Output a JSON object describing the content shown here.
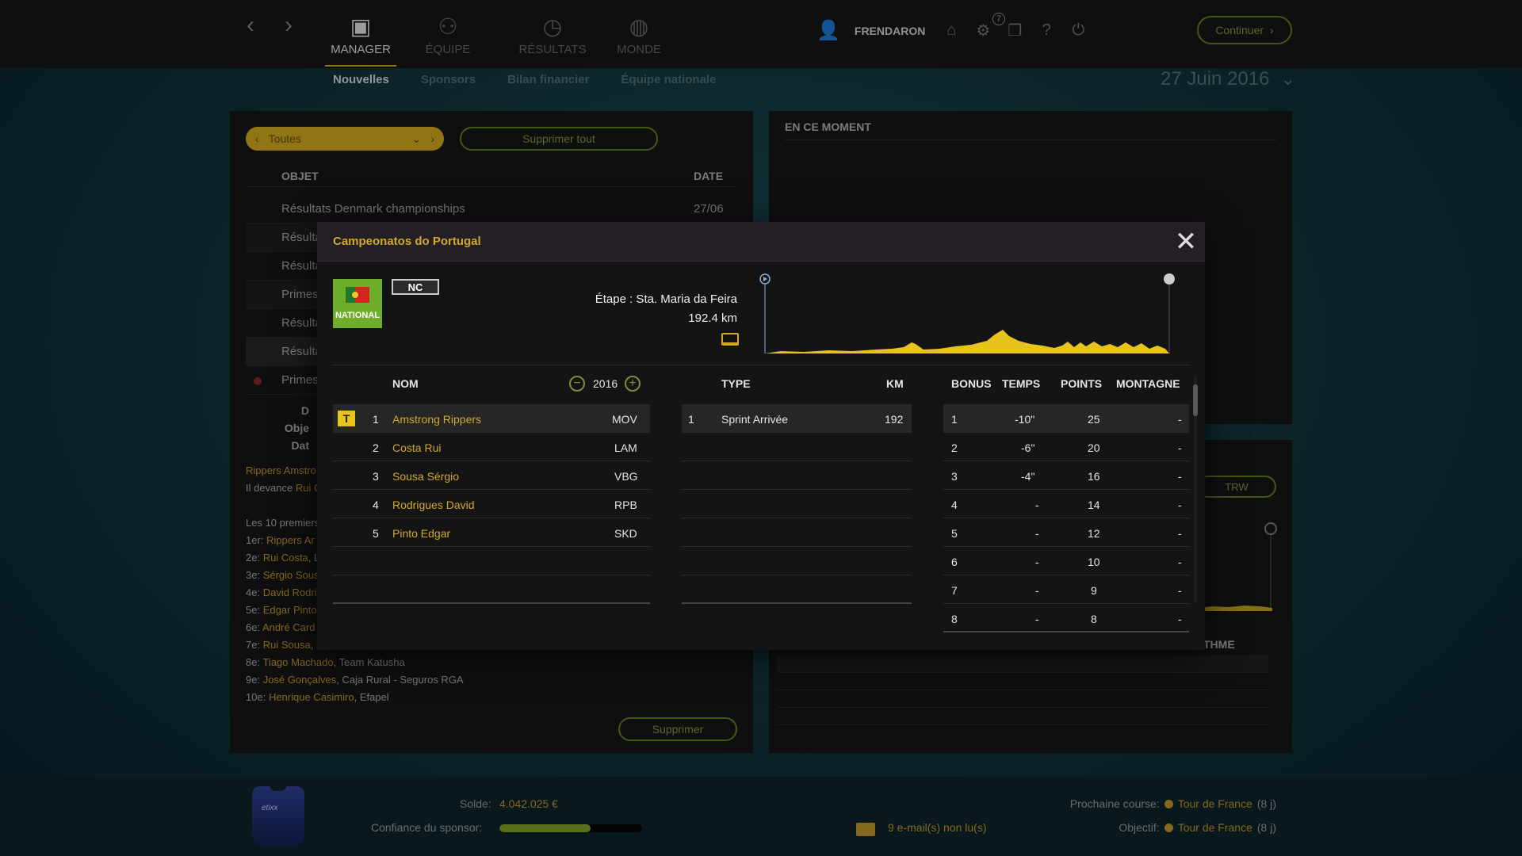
{
  "nav": {
    "main_tabs": [
      {
        "label": "MANAGER",
        "icon": "briefcase-icon"
      },
      {
        "label": "ÉQUIPE",
        "icon": "team-icon"
      },
      {
        "label": "RÉSULTATS",
        "icon": "stopwatch-icon"
      },
      {
        "label": "MONDE",
        "icon": "globe-icon"
      }
    ],
    "sub_tabs": [
      "Nouvelles",
      "Sponsors",
      "Bilan financier",
      "Équipe nationale"
    ],
    "username": "FRENDARON",
    "notif_count": "7",
    "continue_label": "Continuer",
    "date": "27 Juin 2016"
  },
  "news": {
    "filter": "Toutes",
    "delete_all": "Supprimer tout",
    "col_object": "OBJET",
    "col_date": "DATE",
    "rows": [
      {
        "title": "Résultats Denmark championships",
        "date": "27/06"
      },
      {
        "title": "Résulta"
      },
      {
        "title": "Résulta"
      },
      {
        "title": "Primes"
      },
      {
        "title": "Résulta"
      },
      {
        "title": "Résulta"
      },
      {
        "title": "Primes"
      }
    ],
    "detail_labels": [
      "D",
      "Obje",
      "Dat"
    ],
    "body": {
      "line1_name": "Rippers Amstro",
      "line2_prefix": "Il devance ",
      "line2_name": "Rui C",
      "top10_title": "Les 10 premiers",
      "top10": [
        {
          "rank": "1er:",
          "name": "Rippers Ar",
          "team": ""
        },
        {
          "rank": "2e:",
          "name": "Rui Costa",
          "team": ", L"
        },
        {
          "rank": "3e:",
          "name": "Sérgio Sous",
          "team": ""
        },
        {
          "rank": "4e:",
          "name": "David Rodri",
          "team": ""
        },
        {
          "rank": "5e:",
          "name": "Edgar Pinto",
          "team": ""
        },
        {
          "rank": "6e:",
          "name": "André Card",
          "team": ""
        },
        {
          "rank": "7e:",
          "name": "Rui Sousa",
          "team": ", R"
        },
        {
          "rank": "8e:",
          "name": "Tiago Machado",
          "team": ", Team Katusha"
        },
        {
          "rank": "9e:",
          "name": "José Gonçalves",
          "team": ", Caja Rural - Seguros RGA"
        },
        {
          "rank": "10e:",
          "name": "Henrique Casimiro",
          "team": ", Efapel"
        }
      ]
    },
    "delete_label": "Supprimer"
  },
  "right": {
    "moment_title": "EN CE MOMENT",
    "trw_label": "TRW",
    "rythme_label": "THME"
  },
  "modal": {
    "title": "Campeonatos do Portugal",
    "flag_label": "NATIONAL",
    "badge": "NC",
    "stage": "Étape : Sta. Maria da Feira",
    "distance": "192.4 km",
    "year": "2016",
    "riders_header": "NOM",
    "riders": [
      {
        "rank": "1",
        "name": "Amstrong Rippers",
        "team": "MOV",
        "badge": "T"
      },
      {
        "rank": "2",
        "name": "Costa Rui",
        "team": "LAM"
      },
      {
        "rank": "3",
        "name": "Sousa Sérgio",
        "team": "VBG"
      },
      {
        "rank": "4",
        "name": "Rodrigues David",
        "team": "RPB"
      },
      {
        "rank": "5",
        "name": "Pinto Edgar",
        "team": "SKD"
      }
    ],
    "type_headers": {
      "type": "TYPE",
      "km": "KM"
    },
    "sprints": [
      {
        "n": "1",
        "type": "Sprint Arrivée",
        "km": "192"
      }
    ],
    "bonus_headers": {
      "bonus": "BONUS",
      "temps": "TEMPS",
      "points": "POINTS",
      "montagne": "MONTAGNE"
    },
    "bonus_rows": [
      {
        "b": "1",
        "t": "-10\"",
        "p": "25",
        "m": "-"
      },
      {
        "b": "2",
        "t": "-6\"",
        "p": "20",
        "m": "-"
      },
      {
        "b": "3",
        "t": "-4\"",
        "p": "16",
        "m": "-"
      },
      {
        "b": "4",
        "t": "-",
        "p": "14",
        "m": "-"
      },
      {
        "b": "5",
        "t": "-",
        "p": "12",
        "m": "-"
      },
      {
        "b": "6",
        "t": "-",
        "p": "10",
        "m": "-"
      },
      {
        "b": "7",
        "t": "-",
        "p": "9",
        "m": "-"
      },
      {
        "b": "8",
        "t": "-",
        "p": "8",
        "m": "-"
      }
    ],
    "profile_color": "#e7c31c"
  },
  "footer": {
    "solde_label": "Solde:",
    "solde_value": "4.042.025 €",
    "confidence_label": "Confiance du sponsor:",
    "confidence_level": 0.64,
    "emails": "9 e-mail(s) non lu(s)",
    "next_race_label": "Prochaine course:",
    "next_race": "Tour de France",
    "next_race_days": "(8 j)",
    "objective_label": "Objectif:",
    "objective_race": "Tour de France",
    "objective_days": "(8 j)",
    "jersey_text": "etixx"
  }
}
